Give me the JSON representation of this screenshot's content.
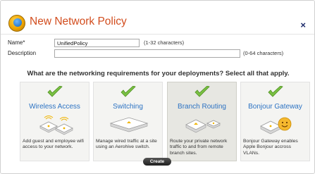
{
  "dialog": {
    "title": "New Network Policy",
    "close_label": "×"
  },
  "form": {
    "name_label": "Name*",
    "name_value": "UnifiedPolicy",
    "name_hint": "(1-32 characters)",
    "description_label": "Description",
    "description_value": "",
    "description_hint": "(0-64 characters)"
  },
  "question": "What are the networking requirements for your deployments? Select all that apply.",
  "cards": [
    {
      "title": "Wireless Access",
      "description": "Add guest and employee wifi access to your network.",
      "selected": false,
      "icon": "wireless-access-points-icon"
    },
    {
      "title": "Switching",
      "description": "Manage wired traffic at a site using an Aerohive switch.",
      "selected": false,
      "icon": "switch-icon"
    },
    {
      "title": "Branch Routing",
      "description": "Route your private network traffic to and from remote branch sites.",
      "selected": true,
      "icon": "branch-router-icon"
    },
    {
      "title": "Bonjour Gateway",
      "description": "Bonjour Gateway enables Apple Bonjour accross VLANs.",
      "selected": false,
      "icon": "bonjour-gateway-icon"
    }
  ],
  "colors": {
    "title": "#d24d1e",
    "card_title": "#2d73c3",
    "check_green": "#7ac143"
  },
  "create_label": "Create"
}
